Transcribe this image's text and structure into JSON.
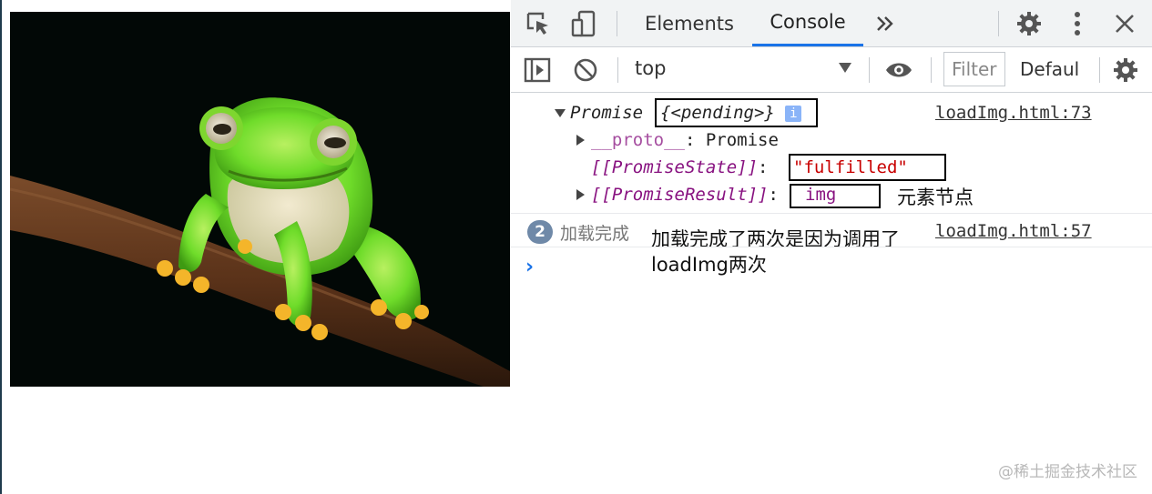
{
  "devtools": {
    "tabs": [
      "Elements",
      "Console"
    ],
    "more_tabs_icon": "double-chevron-right",
    "toolbar_icons": [
      "inspect-element-icon",
      "device-toggle-icon",
      "settings-icon",
      "more-vert-icon",
      "close-icon"
    ],
    "context": "top",
    "filter_placeholder": "Filter",
    "levels": "Defaul"
  },
  "console": {
    "promise_label": "Promise",
    "promise_state_inline": "{<pending>}",
    "info_badge": "i",
    "source_1": "loadImg.html:73",
    "proto_key": "__proto__",
    "proto_sep": ": ",
    "proto_value": "Promise",
    "state_key": "[[PromiseState]]",
    "state_sep": ": ",
    "state_value": "\"fulfilled\"",
    "result_key": "[[PromiseResult]]",
    "result_sep": ": ",
    "result_value": "img",
    "result_note": "元素节点",
    "log_count": "2",
    "log_message": "加载完成",
    "source_2": "loadImg.html:57",
    "annotation_line1": "加载完成了两次是因为调用了",
    "annotation_line2": "loadImg两次",
    "prompt": "›"
  },
  "watermark": "@稀土掘金技术社区",
  "colors": {
    "accent": "#1a73e8",
    "key_purple": "#881280",
    "string_red": "#c80000",
    "badge_blue": "#6f89a8",
    "frog_green": "#6fdc2a"
  }
}
